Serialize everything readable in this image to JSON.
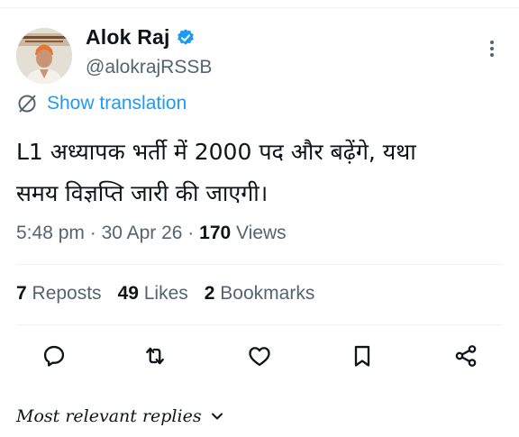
{
  "author": {
    "name": "Alok Raj",
    "handle": "@alokrajRSSB",
    "verified_color": "#1d9bf0"
  },
  "translation": {
    "label": "Show translation",
    "icon": "globe-icon"
  },
  "tweet": {
    "lines": [
      "L1 अध्यापक भर्ती में 2000 पद और बढ़ेंगे, यथा",
      "समय  विज्ञप्ति जारी की जाएगी।"
    ]
  },
  "meta": {
    "time": "5:48 pm",
    "sep1": " · ",
    "date": "30 Apr 26",
    "sep2": " · ",
    "views_count": "170",
    "views_label": " Views"
  },
  "stats": {
    "reposts_count": "7",
    "reposts_label": " Reposts",
    "likes_count": "49",
    "likes_label": " Likes",
    "bookmarks_count": "2",
    "bookmarks_label": " Bookmarks"
  },
  "actions": [
    "reply-icon",
    "repost-icon",
    "like-icon",
    "bookmark-icon",
    "share-icon"
  ],
  "replies_filter": {
    "label": "Most relevant replies"
  },
  "colors": {
    "accent": "#1d9bf0",
    "text": "#0f1419",
    "secondary": "#536471",
    "divider": "#eff3f4"
  }
}
